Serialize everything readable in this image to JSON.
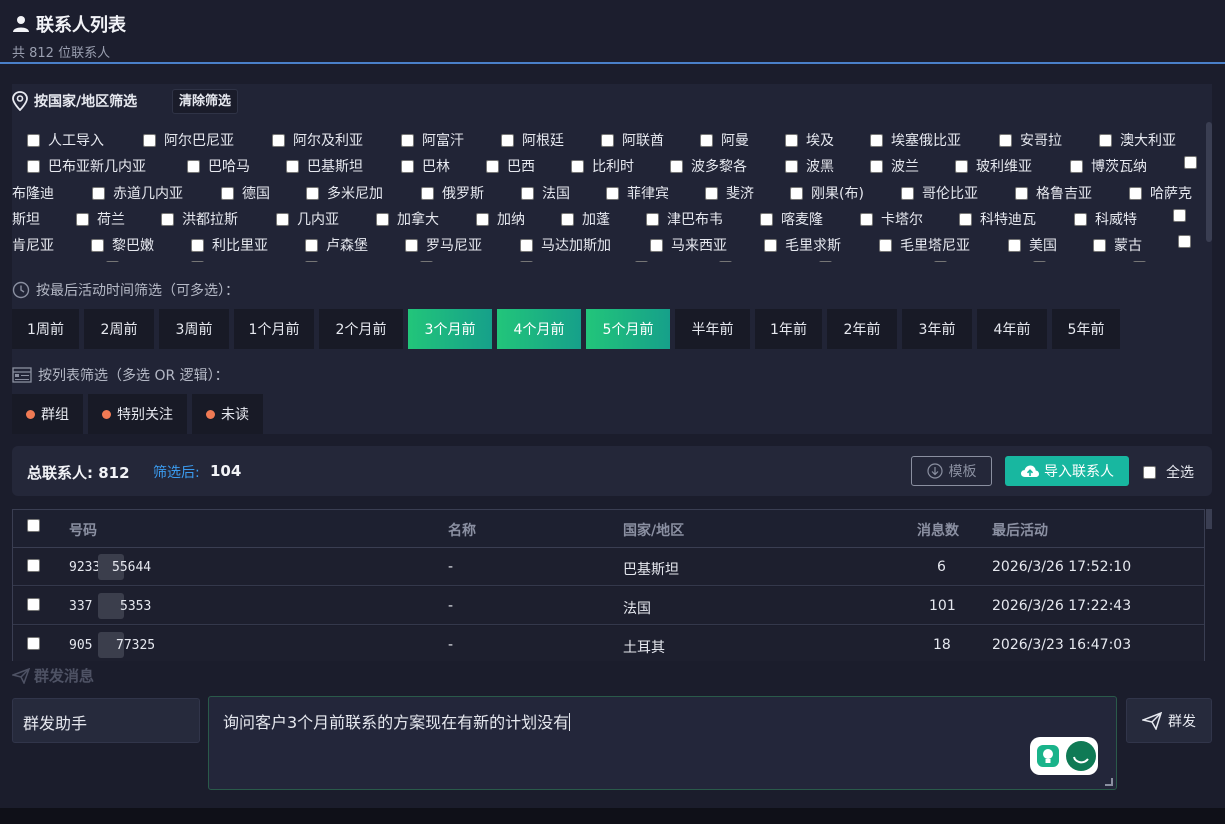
{
  "header": {
    "title": "联系人列表",
    "subtitle": "共 812 位联系人"
  },
  "country_filter": {
    "label": "按国家/地区筛选",
    "clear_label": "清除筛选",
    "rows": [
      [
        "人工导入",
        "阿尔巴尼亚",
        "阿尔及利亚",
        "阿富汗",
        "阿根廷",
        "阿联酋",
        "阿曼",
        "埃及",
        "埃塞俄比亚",
        "安哥拉",
        "澳大利亚"
      ],
      [
        "巴布亚新几内亚",
        "巴哈马",
        "巴基斯坦",
        "巴林",
        "巴西",
        "比利时",
        "波多黎各",
        "波黑",
        "波兰",
        "玻利维亚",
        "博茨瓦纳"
      ],
      [
        "布隆迪",
        "赤道几内亚",
        "德国",
        "多米尼加",
        "俄罗斯",
        "法国",
        "菲律宾",
        "斐济",
        "刚果(布)",
        "哥伦比亚",
        "格鲁吉亚",
        "哈萨克"
      ],
      [
        "斯坦",
        "荷兰",
        "洪都拉斯",
        "几内亚",
        "加拿大",
        "加纳",
        "加蓬",
        "津巴布韦",
        "喀麦隆",
        "卡塔尔",
        "科特迪瓦",
        "科威特"
      ],
      [
        "肯尼亚",
        "黎巴嫩",
        "利比里亚",
        "卢森堡",
        "罗马尼亚",
        "马达加斯加",
        "马来西亚",
        "毛里求斯",
        "毛里塔尼亚",
        "美国",
        "蒙古"
      ]
    ]
  },
  "time_filter": {
    "label": "按最后活动时间筛选（可多选）：",
    "options": [
      {
        "label": "1周前",
        "selected": false
      },
      {
        "label": "2周前",
        "selected": false
      },
      {
        "label": "3周前",
        "selected": false
      },
      {
        "label": "1个月前",
        "selected": false
      },
      {
        "label": "2个月前",
        "selected": false
      },
      {
        "label": "3个月前",
        "selected": true
      },
      {
        "label": "4个月前",
        "selected": true
      },
      {
        "label": "5个月前",
        "selected": true
      },
      {
        "label": "半年前",
        "selected": false
      },
      {
        "label": "1年前",
        "selected": false
      },
      {
        "label": "2年前",
        "selected": false
      },
      {
        "label": "3年前",
        "selected": false
      },
      {
        "label": "4年前",
        "selected": false
      },
      {
        "label": "5年前",
        "selected": false
      }
    ]
  },
  "list_filter": {
    "label": "按列表筛选（多选 OR 逻辑）：",
    "options": [
      "群组",
      "特别关注",
      "未读"
    ]
  },
  "stats": {
    "total_label": "总联系人: 812",
    "filtered_label": "筛选后:",
    "filtered_value": "104",
    "template_label": "模板",
    "import_label": "导入联系人",
    "select_all_label": "全选"
  },
  "table": {
    "headers": [
      "号码",
      "名称",
      "国家/地区",
      "消息数",
      "最后活动"
    ],
    "rows": [
      {
        "number_start": "9233",
        "number_end": "55644",
        "name": "-",
        "country": "巴基斯坦",
        "messages": "6",
        "last_active": "2026/3/26 17:52:10"
      },
      {
        "number_start": "337",
        "number_end": "5353",
        "name": "-",
        "country": "法国",
        "messages": "101",
        "last_active": "2026/3/26 17:22:43"
      },
      {
        "number_start": "905",
        "number_end": "77325",
        "name": "-",
        "country": "土耳其",
        "messages": "18",
        "last_active": "2026/3/23 16:47:03"
      }
    ]
  },
  "broadcast": {
    "section_label": "群发消息",
    "helper_label": "群发助手",
    "message_value": "询问客户3个月前联系的方案现在有新的计划没有",
    "send_label": "群发"
  },
  "colors": {
    "accent_green": "#22c57a",
    "accent_teal": "#18b7a0",
    "link_blue": "#3b9cf0",
    "dot_orange": "#f07a54"
  }
}
